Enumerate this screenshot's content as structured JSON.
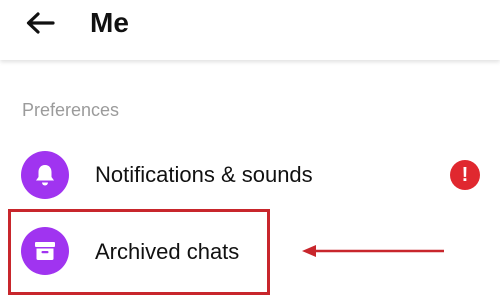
{
  "header": {
    "title": "Me",
    "back_icon": "arrow-left-icon"
  },
  "preferences": {
    "section_label": "Preferences",
    "items": [
      {
        "label": "Notifications & sounds",
        "icon": "bell-icon",
        "badge": "!",
        "badge_color": "#e0282f"
      },
      {
        "label": "Archived chats",
        "icon": "archive-box-icon"
      }
    ]
  },
  "colors": {
    "accent": "#a034f0",
    "annotation": "#c8262c"
  }
}
